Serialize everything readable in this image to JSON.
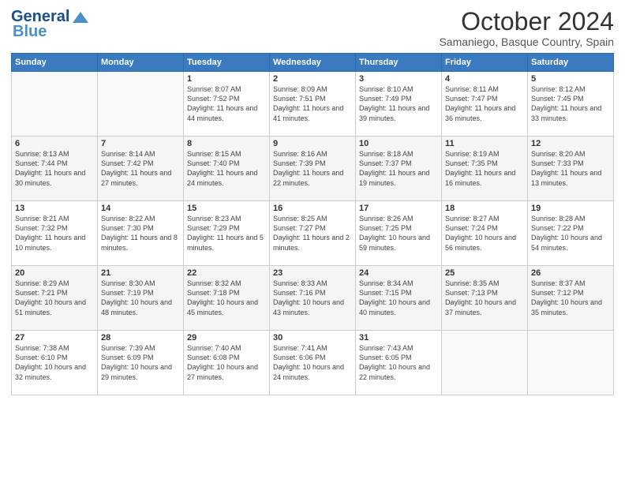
{
  "header": {
    "logo_line1": "General",
    "logo_line2": "Blue",
    "month": "October 2024",
    "location": "Samaniego, Basque Country, Spain"
  },
  "weekdays": [
    "Sunday",
    "Monday",
    "Tuesday",
    "Wednesday",
    "Thursday",
    "Friday",
    "Saturday"
  ],
  "weeks": [
    [
      {
        "day": "",
        "info": ""
      },
      {
        "day": "",
        "info": ""
      },
      {
        "day": "1",
        "info": "Sunrise: 8:07 AM\nSunset: 7:52 PM\nDaylight: 11 hours and 44 minutes."
      },
      {
        "day": "2",
        "info": "Sunrise: 8:09 AM\nSunset: 7:51 PM\nDaylight: 11 hours and 41 minutes."
      },
      {
        "day": "3",
        "info": "Sunrise: 8:10 AM\nSunset: 7:49 PM\nDaylight: 11 hours and 39 minutes."
      },
      {
        "day": "4",
        "info": "Sunrise: 8:11 AM\nSunset: 7:47 PM\nDaylight: 11 hours and 36 minutes."
      },
      {
        "day": "5",
        "info": "Sunrise: 8:12 AM\nSunset: 7:45 PM\nDaylight: 11 hours and 33 minutes."
      }
    ],
    [
      {
        "day": "6",
        "info": "Sunrise: 8:13 AM\nSunset: 7:44 PM\nDaylight: 11 hours and 30 minutes."
      },
      {
        "day": "7",
        "info": "Sunrise: 8:14 AM\nSunset: 7:42 PM\nDaylight: 11 hours and 27 minutes."
      },
      {
        "day": "8",
        "info": "Sunrise: 8:15 AM\nSunset: 7:40 PM\nDaylight: 11 hours and 24 minutes."
      },
      {
        "day": "9",
        "info": "Sunrise: 8:16 AM\nSunset: 7:39 PM\nDaylight: 11 hours and 22 minutes."
      },
      {
        "day": "10",
        "info": "Sunrise: 8:18 AM\nSunset: 7:37 PM\nDaylight: 11 hours and 19 minutes."
      },
      {
        "day": "11",
        "info": "Sunrise: 8:19 AM\nSunset: 7:35 PM\nDaylight: 11 hours and 16 minutes."
      },
      {
        "day": "12",
        "info": "Sunrise: 8:20 AM\nSunset: 7:33 PM\nDaylight: 11 hours and 13 minutes."
      }
    ],
    [
      {
        "day": "13",
        "info": "Sunrise: 8:21 AM\nSunset: 7:32 PM\nDaylight: 11 hours and 10 minutes."
      },
      {
        "day": "14",
        "info": "Sunrise: 8:22 AM\nSunset: 7:30 PM\nDaylight: 11 hours and 8 minutes."
      },
      {
        "day": "15",
        "info": "Sunrise: 8:23 AM\nSunset: 7:29 PM\nDaylight: 11 hours and 5 minutes."
      },
      {
        "day": "16",
        "info": "Sunrise: 8:25 AM\nSunset: 7:27 PM\nDaylight: 11 hours and 2 minutes."
      },
      {
        "day": "17",
        "info": "Sunrise: 8:26 AM\nSunset: 7:25 PM\nDaylight: 10 hours and 59 minutes."
      },
      {
        "day": "18",
        "info": "Sunrise: 8:27 AM\nSunset: 7:24 PM\nDaylight: 10 hours and 56 minutes."
      },
      {
        "day": "19",
        "info": "Sunrise: 8:28 AM\nSunset: 7:22 PM\nDaylight: 10 hours and 54 minutes."
      }
    ],
    [
      {
        "day": "20",
        "info": "Sunrise: 8:29 AM\nSunset: 7:21 PM\nDaylight: 10 hours and 51 minutes."
      },
      {
        "day": "21",
        "info": "Sunrise: 8:30 AM\nSunset: 7:19 PM\nDaylight: 10 hours and 48 minutes."
      },
      {
        "day": "22",
        "info": "Sunrise: 8:32 AM\nSunset: 7:18 PM\nDaylight: 10 hours and 45 minutes."
      },
      {
        "day": "23",
        "info": "Sunrise: 8:33 AM\nSunset: 7:16 PM\nDaylight: 10 hours and 43 minutes."
      },
      {
        "day": "24",
        "info": "Sunrise: 8:34 AM\nSunset: 7:15 PM\nDaylight: 10 hours and 40 minutes."
      },
      {
        "day": "25",
        "info": "Sunrise: 8:35 AM\nSunset: 7:13 PM\nDaylight: 10 hours and 37 minutes."
      },
      {
        "day": "26",
        "info": "Sunrise: 8:37 AM\nSunset: 7:12 PM\nDaylight: 10 hours and 35 minutes."
      }
    ],
    [
      {
        "day": "27",
        "info": "Sunrise: 7:38 AM\nSunset: 6:10 PM\nDaylight: 10 hours and 32 minutes."
      },
      {
        "day": "28",
        "info": "Sunrise: 7:39 AM\nSunset: 6:09 PM\nDaylight: 10 hours and 29 minutes."
      },
      {
        "day": "29",
        "info": "Sunrise: 7:40 AM\nSunset: 6:08 PM\nDaylight: 10 hours and 27 minutes."
      },
      {
        "day": "30",
        "info": "Sunrise: 7:41 AM\nSunset: 6:06 PM\nDaylight: 10 hours and 24 minutes."
      },
      {
        "day": "31",
        "info": "Sunrise: 7:43 AM\nSunset: 6:05 PM\nDaylight: 10 hours and 22 minutes."
      },
      {
        "day": "",
        "info": ""
      },
      {
        "day": "",
        "info": ""
      }
    ]
  ]
}
